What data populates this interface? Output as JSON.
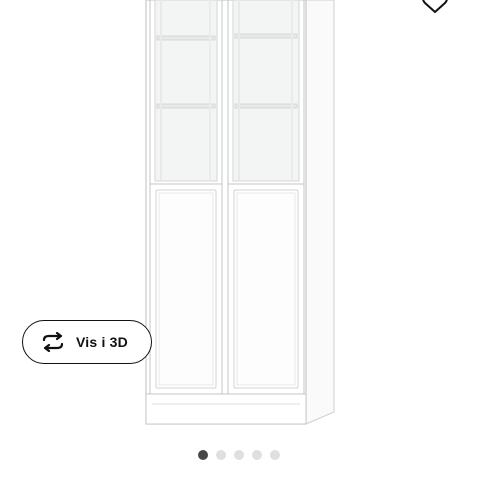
{
  "product_view": {
    "view3d_label": "Vis i 3D",
    "view3d_icon": "rotate-arrows-icon",
    "favourite_icon": "heart-icon"
  },
  "carousel": {
    "total": 5,
    "active_index": 0,
    "active_color": "#484848",
    "inactive_color": "#dfdfdf"
  },
  "colors": {
    "cabinet_frame": "#ffffff",
    "cabinet_outline": "#c9c9c9",
    "glass_tint": "#f3f5f4"
  }
}
